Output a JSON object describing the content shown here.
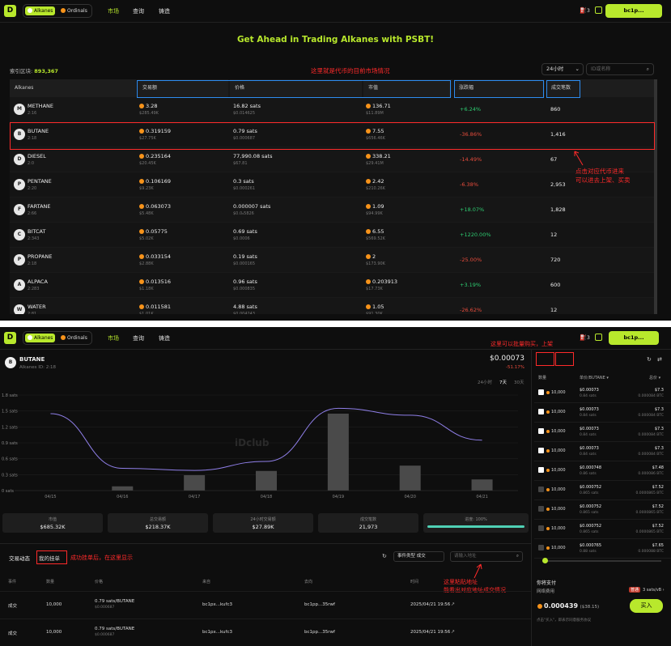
{
  "nav": {
    "tab_alkanes": "Alkanes",
    "tab_ordinals": "Ordinals",
    "links": [
      "市场",
      "查询",
      "铸造"
    ],
    "gas": "3",
    "wallet_top": "bc1p...",
    "wallet_bottom": "bc1p..."
  },
  "market": {
    "headline": "Get Ahead in Trading Alkanes with PSBT!",
    "block_label": "索引区块:",
    "block_value": "893,367",
    "annotation_market": "这里就是代币的目前市场情况",
    "annotation_click": [
      "点击对应代币进来",
      "可以进去上架、买卖"
    ],
    "timeframe": "24小时",
    "search_placeholder": "ID或名称",
    "columns": [
      "Alkanes",
      "交易额",
      "价格",
      "市值",
      "涨跌幅",
      "成交笔数"
    ],
    "rows": [
      {
        "icon": "M",
        "name": "METHANE",
        "id": "2:16",
        "vol": "3.28",
        "vol_usd": "$285.49K",
        "price": "16.82 sats",
        "price_btc": "$0.014625",
        "mcap": "136.71",
        "mcap_usd": "$11.89M",
        "change": "+6.24%",
        "dir": "pos",
        "trades": "860"
      },
      {
        "icon": "B",
        "name": "BUTANE",
        "id": "2:18",
        "vol": "0.319159",
        "vol_usd": "$27.75K",
        "price": "0.79 sats",
        "price_btc": "$0.000687",
        "mcap": "7.55",
        "mcap_usd": "$656.46K",
        "change": "-36.86%",
        "dir": "neg",
        "trades": "1,416"
      },
      {
        "icon": "D",
        "name": "DIESEL",
        "id": "2:0",
        "vol": "0.235164",
        "vol_usd": "$20.45K",
        "price": "77,990.08 sats",
        "price_btc": "$67.81",
        "mcap": "338.21",
        "mcap_usd": "$29.41M",
        "change": "-14.49%",
        "dir": "neg",
        "trades": "67"
      },
      {
        "icon": "P",
        "name": "PENTANE",
        "id": "2:20",
        "vol": "0.106169",
        "vol_usd": "$9.23K",
        "price": "0.3 sats",
        "price_btc": "$0.000261",
        "mcap": "2.42",
        "mcap_usd": "$210.26K",
        "change": "-6.38%",
        "dir": "neg",
        "trades": "2,953"
      },
      {
        "icon": "F",
        "name": "FARTANE",
        "id": "2:66",
        "vol": "0.063073",
        "vol_usd": "$5.48K",
        "price": "0.000007 sats",
        "price_btc": "$0.0₈5826",
        "mcap": "1.09",
        "mcap_usd": "$94.99K",
        "change": "+18.07%",
        "dir": "pos",
        "trades": "1,828"
      },
      {
        "icon": "C",
        "name": "BITCAT",
        "id": "2:343",
        "vol": "0.05775",
        "vol_usd": "$5.02K",
        "price": "0.69 sats",
        "price_btc": "$0.0006",
        "mcap": "6.55",
        "mcap_usd": "$569.52K",
        "change": "+1220.00%",
        "dir": "pos",
        "trades": "12"
      },
      {
        "icon": "P",
        "name": "PROPANE",
        "id": "2:18",
        "vol": "0.033154",
        "vol_usd": "$2.88K",
        "price": "0.19 sats",
        "price_btc": "$0.000165",
        "mcap": "2",
        "mcap_usd": "$173.90K",
        "change": "-25.00%",
        "dir": "neg",
        "trades": "720"
      },
      {
        "icon": "A",
        "name": "ALPACA",
        "id": "2:283",
        "vol": "0.013516",
        "vol_usd": "$1.18K",
        "price": "0.96 sats",
        "price_btc": "$0.000835",
        "mcap": "0.203913",
        "mcap_usd": "$17.73K",
        "change": "+3.19%",
        "dir": "pos",
        "trades": "600"
      },
      {
        "icon": "W",
        "name": "WATER",
        "id": "2:81",
        "vol": "0.011581",
        "vol_usd": "$1.01K",
        "price": "4.88 sats",
        "price_btc": "$0.004243",
        "mcap": "1.05",
        "mcap_usd": "$91.30K",
        "change": "-26.62%",
        "dir": "neg",
        "trades": "12"
      }
    ]
  },
  "token": {
    "name": "BUTANE",
    "id_label": "Alkanes ID: 2:18",
    "price": "$0.00073",
    "change": "-51.17%",
    "ranges": [
      "24小时",
      "7天",
      "30天"
    ],
    "annotation_buy": "这里可以批量购买，上架",
    "buy_tab": "购买",
    "sell_tab": "出售",
    "y_ticks": [
      "1.8 sats",
      "1.5 sats",
      "1.2 sats",
      "0.9 sats",
      "0.6 sats",
      "0.3 sats",
      "0 sats"
    ],
    "x_ticks": [
      "04/15",
      "04/16",
      "04/17",
      "04/18",
      "04/19",
      "04/20",
      "04/21"
    ],
    "stats": [
      {
        "label": "市值",
        "value": "$685.32K"
      },
      {
        "label": "总交易额",
        "value": "$218.37K"
      },
      {
        "label": "24小时交易额",
        "value": "$27.89K"
      },
      {
        "label": "成交笔数",
        "value": "21,973"
      },
      {
        "label": "进度: 100%",
        "value": ""
      }
    ],
    "watermark": "iDclub"
  },
  "chart_data": {
    "type": "bar",
    "categories": [
      "04/15",
      "04/16",
      "04/17",
      "04/18",
      "04/19",
      "04/20",
      "04/21"
    ],
    "series": [
      {
        "values": [
          0,
          0.08,
          0.29,
          0.37,
          1.45,
          0.47,
          0.21
        ]
      }
    ],
    "line": [
      1.45,
      0.42,
      0.38,
      0.55,
      1.55,
      1.42,
      0.95
    ],
    "ylim": [
      0,
      1.8
    ]
  },
  "orderbook": {
    "col_qty": "数量",
    "col_unit": "单价/BUTANE ▾",
    "col_total": "总价 ▾",
    "rows": [
      {
        "qty": "10,000",
        "unit": "$0.00073",
        "sats": "0.84 sats",
        "total": "$7.3",
        "btc": "0.000084 BTC",
        "checked": true
      },
      {
        "qty": "10,000",
        "unit": "$0.00073",
        "sats": "0.84 sats",
        "total": "$7.3",
        "btc": "0.000084 BTC",
        "checked": true
      },
      {
        "qty": "10,000",
        "unit": "$0.00073",
        "sats": "0.84 sats",
        "total": "$7.3",
        "btc": "0.000084 BTC",
        "checked": true
      },
      {
        "qty": "10,000",
        "unit": "$0.00073",
        "sats": "0.84 sats",
        "total": "$7.3",
        "btc": "0.000084 BTC",
        "checked": true
      },
      {
        "qty": "10,000",
        "unit": "$0.000748",
        "sats": "0.86 sats",
        "total": "$7.48",
        "btc": "0.000086 BTC",
        "checked": true
      },
      {
        "qty": "10,000",
        "unit": "$0.000752",
        "sats": "0.865 sats",
        "total": "$7.52",
        "btc": "0.0000865 BTC",
        "checked": false
      },
      {
        "qty": "10,000",
        "unit": "$0.000752",
        "sats": "0.865 sats",
        "total": "$7.52",
        "btc": "0.0000865 BTC",
        "checked": false
      },
      {
        "qty": "10,000",
        "unit": "$0.000752",
        "sats": "0.865 sats",
        "total": "$7.52",
        "btc": "0.0000865 BTC",
        "checked": false
      },
      {
        "qty": "10,000",
        "unit": "$0.000765",
        "sats": "0.88 sats",
        "total": "$7.65",
        "btc": "0.000088 BTC",
        "checked": false
      }
    ],
    "pay_label": "你将支付",
    "fee_label": "网络费用",
    "fee_badge": "普通",
    "fee_value": "3 sats/vB ›",
    "pay_amount": "0.000439",
    "pay_usd": "($38.15)",
    "buy_button": "买入",
    "terms": "点击\"买入\"，即表示同意服务协议"
  },
  "activity": {
    "tab_trades": "交易动态",
    "tab_mine": "我的挂单",
    "annotation_mine": "成功挂单后，在这里显示",
    "filter": "事件类型 成交",
    "addr_placeholder": "请输入地址",
    "annotation_addr": [
      "这里粘贴地址",
      "能看出对应地址成交情况"
    ],
    "columns": [
      "事件",
      "数量",
      "价格",
      "来自",
      "去向",
      "时间"
    ],
    "rows": [
      {
        "event": "成交",
        "qty": "10,000",
        "price": "0.79 sats/BUTANE",
        "price_usd": "$0.000687",
        "from": "bc1px...kufc3",
        "to": "bc1pp...35rwf",
        "time": "2025/04/21 19:56"
      },
      {
        "event": "成交",
        "qty": "10,000",
        "price": "0.79 sats/BUTANE",
        "price_usd": "$0.000687",
        "from": "bc1px...kufc3",
        "to": "bc1pp...35rwf",
        "time": "2025/04/21 19:56"
      }
    ]
  }
}
